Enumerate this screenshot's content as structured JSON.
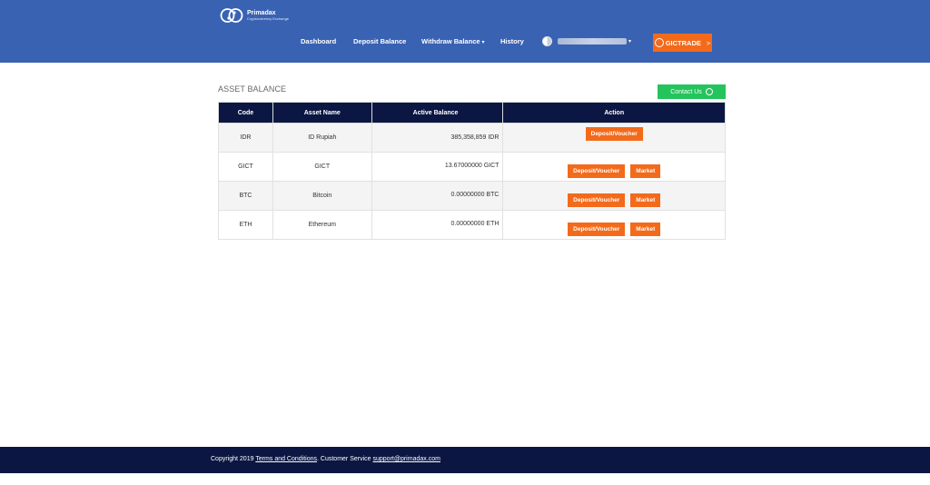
{
  "brand": {
    "name": "Primadax",
    "tagline": "Cryptocurrency Exchange",
    "logo_icon": "link-rings-icon"
  },
  "nav": {
    "dashboard": "Dashboard",
    "deposit_balance": "Deposit Balance",
    "withdraw_balance": "Withdraw Balance",
    "history": "History",
    "caret": "▾"
  },
  "gict_button": {
    "label": "GICTRADE",
    "arrow": ">"
  },
  "section": {
    "title": "ASSET BALANCE"
  },
  "contact_button": {
    "label": "Contact Us",
    "icon": "whatsapp-icon"
  },
  "table": {
    "headers": [
      "Code",
      "Asset Name",
      "Active Balance",
      "Action"
    ],
    "rows": [
      {
        "code": "IDR",
        "name": "ID Rupiah",
        "balance": "385,358,859 IDR",
        "actions": [
          "Deposit/Voucher"
        ]
      },
      {
        "code": "GICT",
        "name": "GICT",
        "balance": "13.67000000 GICT",
        "actions": [
          "Deposit/Voucher",
          "Market"
        ]
      },
      {
        "code": "BTC",
        "name": "Bitcoin",
        "balance": "0.00000000 BTC",
        "actions": [
          "Deposit/Voucher",
          "Market"
        ]
      },
      {
        "code": "ETH",
        "name": "Ethereum",
        "balance": "0.00000000 ETH",
        "actions": [
          "Deposit/Voucher",
          "Market"
        ]
      }
    ]
  },
  "footer": {
    "copyright": "Copyright 2019",
    "terms": "Terms and Conditions",
    "service_prefix": ". Customer Service",
    "email": "support@primadax.com"
  },
  "colors": {
    "header": "#3a62b3",
    "accent": "#f36a1b",
    "table_head": "#0b1742",
    "contact": "#24c45c"
  }
}
